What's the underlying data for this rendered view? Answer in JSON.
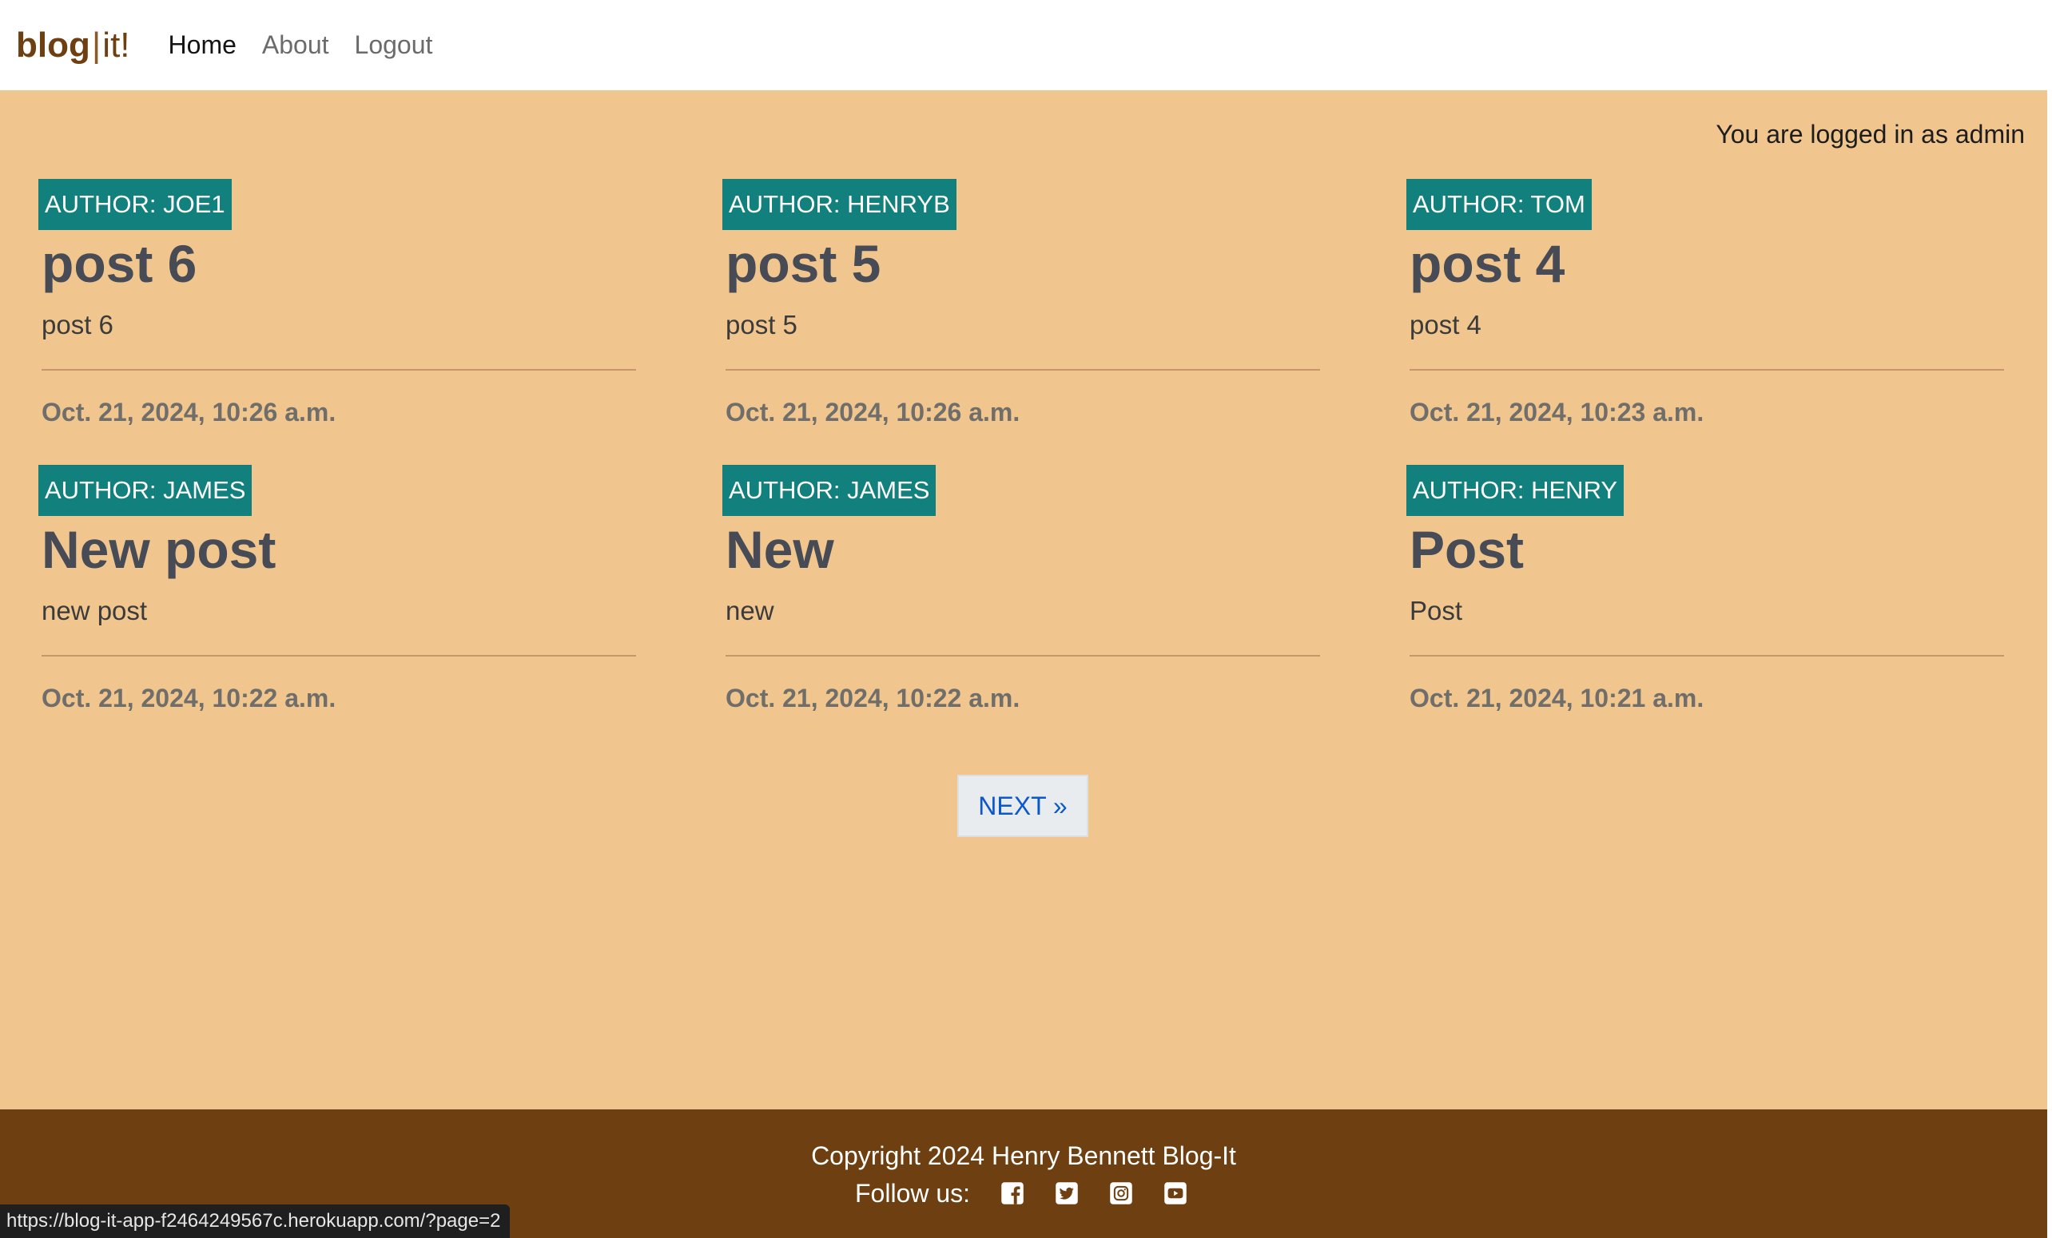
{
  "nav": {
    "brand_bold": "blog",
    "brand_sep": "|",
    "brand_rest": "it!",
    "links": [
      {
        "label": "Home",
        "active": true
      },
      {
        "label": "About",
        "active": false
      },
      {
        "label": "Logout",
        "active": false
      }
    ]
  },
  "login_status": "You are logged in as admin",
  "posts": [
    {
      "author": "AUTHOR: JOE1",
      "title": "post 6",
      "excerpt": "post 6",
      "date": "Oct. 21, 2024, 10:26 a.m."
    },
    {
      "author": "AUTHOR: HENRYB",
      "title": "post 5",
      "excerpt": "post 5",
      "date": "Oct. 21, 2024, 10:26 a.m."
    },
    {
      "author": "AUTHOR: TOM",
      "title": "post 4",
      "excerpt": "post 4",
      "date": "Oct. 21, 2024, 10:23 a.m."
    },
    {
      "author": "AUTHOR: JAMES",
      "title": "New post",
      "excerpt": "new post",
      "date": "Oct. 21, 2024, 10:22 a.m."
    },
    {
      "author": "AUTHOR: JAMES",
      "title": "New",
      "excerpt": "new",
      "date": "Oct. 21, 2024, 10:22 a.m."
    },
    {
      "author": "AUTHOR: HENRY",
      "title": "Post",
      "excerpt": "Post",
      "date": "Oct. 21, 2024, 10:21 a.m."
    }
  ],
  "pagination": {
    "next_label": "NEXT »"
  },
  "footer": {
    "copyright": "Copyright 2024 Henry Bennett Blog-It",
    "follow_label": "Follow us:",
    "social_icons": [
      "facebook-icon",
      "twitter-icon",
      "instagram-icon",
      "youtube-icon"
    ]
  },
  "status_url": "https://blog-it-app-f2464249567c.herokuapp.com/?page=2",
  "colors": {
    "page_bg": "#f0c58e",
    "badge_bg": "#12807c",
    "footer_bg": "#6e3f10",
    "brand": "#6e3f10",
    "link_blue": "#0a58ca"
  }
}
